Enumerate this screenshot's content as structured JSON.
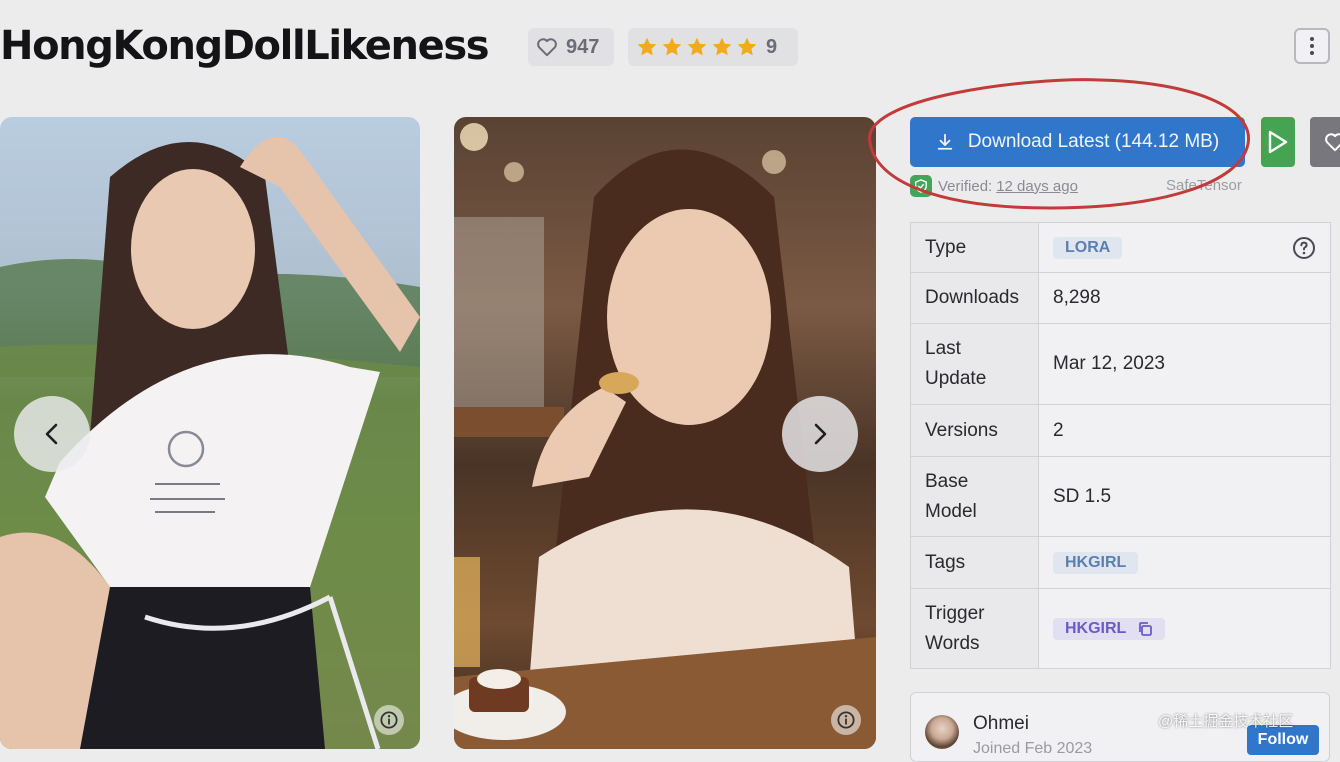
{
  "model": {
    "title": "HongKongDollLikeness",
    "likes": "947",
    "rating_count": "9",
    "rating_stars": 5
  },
  "download": {
    "label": "Download Latest (144.12 MB)",
    "verified_prefix": "Verified:",
    "verified_date": "12 days ago",
    "format": "SafeTensor"
  },
  "details": [
    {
      "label": "Type",
      "value": "LORA"
    },
    {
      "label": "Downloads",
      "value": "8,298"
    },
    {
      "label": "Last Update",
      "value": "Mar 12, 2023"
    },
    {
      "label": "Versions",
      "value": "2"
    },
    {
      "label": "Base Model",
      "value": "SD 1.5"
    },
    {
      "label": "Tags",
      "value": "HKGIRL"
    },
    {
      "label": "Trigger Words",
      "value": "HKGIRL"
    }
  ],
  "creator": {
    "name": "Ohmei",
    "joined": "Joined Feb 2023",
    "follow_label": "Follow"
  },
  "watermark": "@稀土掘金技术社区",
  "colors": {
    "primary": "#3077cc",
    "success": "#45a452",
    "annotation_red": "#c23a3a",
    "star": "#f2a91a"
  },
  "icons": [
    "heart-icon",
    "star-icon",
    "more-vertical-icon",
    "download-icon",
    "play-icon",
    "chevron-left-icon",
    "chevron-right-icon",
    "info-icon",
    "help-icon",
    "copy-icon",
    "verified-icon"
  ]
}
